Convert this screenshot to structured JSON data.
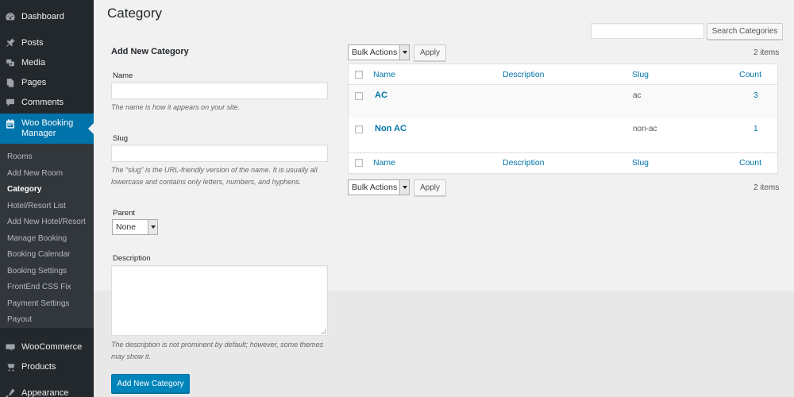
{
  "sidebar": {
    "top_items": [
      {
        "label": "Dashboard",
        "icon": "dashboard-icon"
      },
      {
        "label": "Posts",
        "icon": "pin-icon"
      },
      {
        "label": "Media",
        "icon": "media-icon"
      },
      {
        "label": "Pages",
        "icon": "pages-icon"
      },
      {
        "label": "Comments",
        "icon": "comment-icon"
      }
    ],
    "active_item": {
      "label": "Woo Booking Manager",
      "icon": "calendar-icon"
    },
    "submenu": [
      "Rooms",
      "Add New Room",
      "Category",
      "Hotel/Resort List",
      "Add New Hotel/Resort",
      "Manage Booking",
      "Booking Calendar",
      "Booking Settings",
      "FrontEnd CSS Fix",
      "Payment Settings",
      "Payout"
    ],
    "current_submenu": "Category",
    "bottom_items": [
      {
        "label": "WooCommerce",
        "icon": "woocommerce-icon"
      },
      {
        "label": "Products",
        "icon": "products-icon"
      },
      {
        "label": "Appearance",
        "icon": "appearance-icon"
      }
    ]
  },
  "page": {
    "title": "Category",
    "search_button": "Search Categories",
    "search_value": ""
  },
  "form": {
    "heading": "Add New Category",
    "name_label": "Name",
    "name_help": "The name is how it appears on your site.",
    "slug_label": "Slug",
    "slug_help": "The “slug” is the URL-friendly version of the name. It is usually all lowercase and contains only letters, numbers, and hyphens.",
    "parent_label": "Parent",
    "parent_value": "None",
    "description_label": "Description",
    "description_help": "The description is not prominent by default; however, some themes may show it.",
    "submit": "Add New Category"
  },
  "table": {
    "bulk_actions": "Bulk Actions",
    "apply": "Apply",
    "item_count": "2 items",
    "columns": [
      "Name",
      "Description",
      "Slug",
      "Count"
    ],
    "rows": [
      {
        "name": "AC",
        "description": "",
        "slug": "ac",
        "count": "3"
      },
      {
        "name": "Non AC",
        "description": "",
        "slug": "non-ac",
        "count": "1"
      }
    ]
  },
  "colors": {
    "sidebar_bg": "#23282d",
    "accent": "#0073aa",
    "primary_button": "#0085ba"
  }
}
